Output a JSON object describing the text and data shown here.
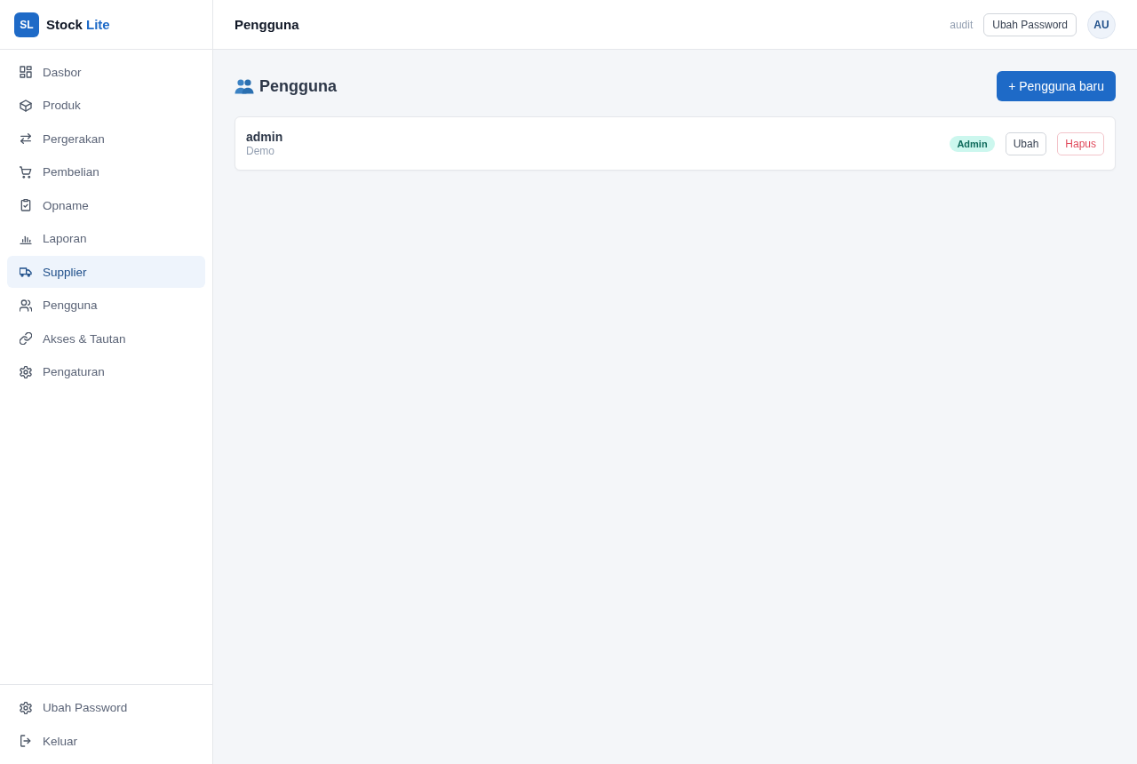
{
  "app": {
    "logo_mark": "SL",
    "name": "Stock",
    "name_accent": "Lite"
  },
  "sidebar": {
    "items": [
      {
        "label": "Dasbor",
        "selected": false
      },
      {
        "label": "Produk",
        "selected": false
      },
      {
        "label": "Pergerakan",
        "selected": false
      },
      {
        "label": "Pembelian",
        "selected": false
      },
      {
        "label": "Opname",
        "selected": false
      },
      {
        "label": "Laporan",
        "selected": false
      },
      {
        "label": "Supplier",
        "selected": true
      },
      {
        "label": "Pengguna",
        "selected": false
      },
      {
        "label": "Akses & Tautan",
        "selected": false
      },
      {
        "label": "Pengaturan",
        "selected": false
      }
    ],
    "footer_items": [
      {
        "label": "Ubah Password"
      },
      {
        "label": "Keluar"
      }
    ]
  },
  "header": {
    "title": "Pengguna",
    "user_role": "audit",
    "change_password_button": "Ubah Password",
    "avatar": "AU"
  },
  "page": {
    "heading": "Pengguna",
    "new_button": "+ Pengguna baru"
  },
  "users": [
    {
      "name": "admin",
      "subtitle": "Demo",
      "role_badge": "Admin",
      "actions": [
        {
          "label": "Ubah",
          "kind": "edit"
        },
        {
          "label": "Hapus",
          "kind": "delete"
        }
      ]
    }
  ]
}
